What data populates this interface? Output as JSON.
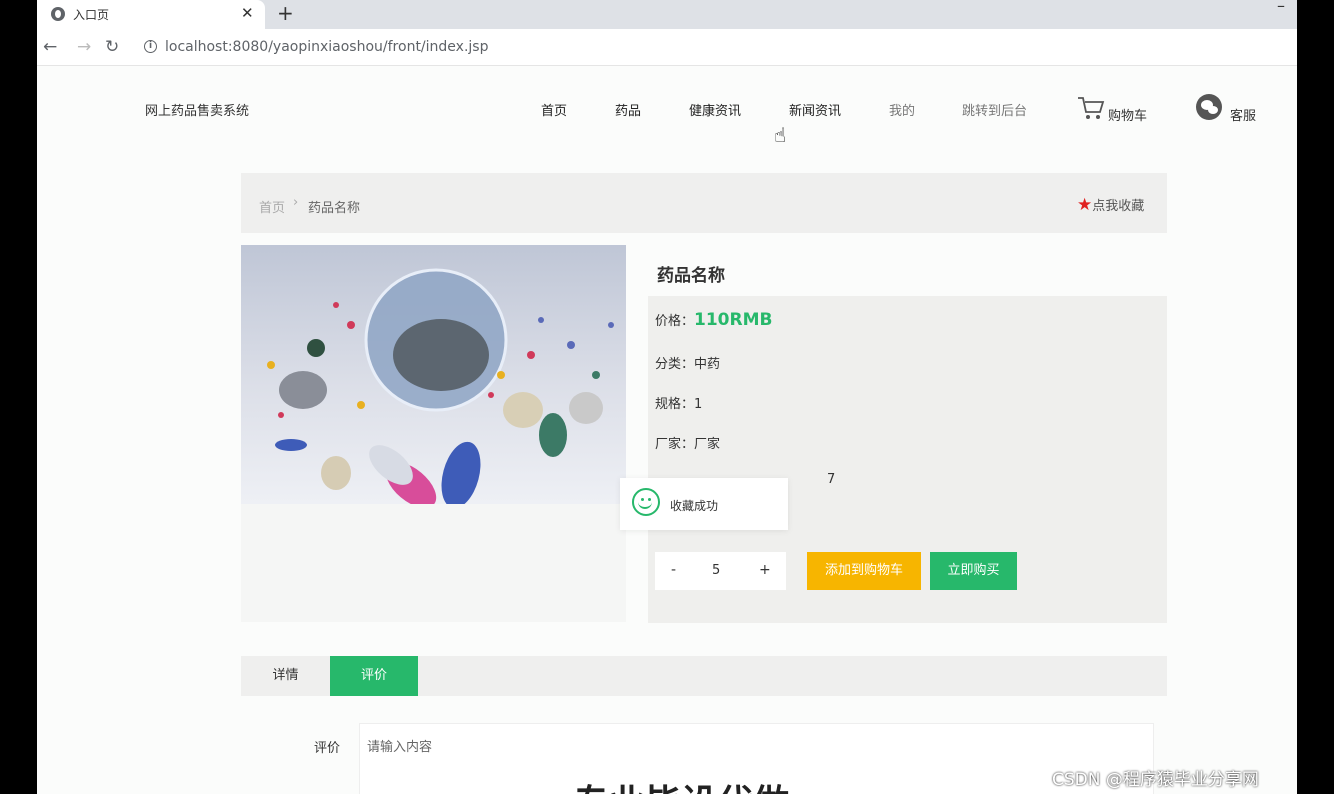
{
  "browser": {
    "tab_title": "入口页",
    "url": "localhost:8080/yaopinxiaoshou/front/index.jsp"
  },
  "header": {
    "site_title": "网上药品售卖系统",
    "nav": [
      "首页",
      "药品",
      "健康资讯",
      "新闻资讯",
      "我的",
      "跳转到后台"
    ],
    "cart_label": "购物车",
    "service_label": "客服"
  },
  "breadcrumb": {
    "home": "首页",
    "separator": "›",
    "current": "药品名称",
    "favorite_label": "点我收藏"
  },
  "product": {
    "name": "药品名称",
    "price_label": "价格：",
    "price_value": "110RMB",
    "category_label": "分类：",
    "category_value": "中药",
    "spec_label": "规格：",
    "spec_value": "1",
    "maker_label": "厂家：",
    "maker_value": "厂家",
    "partial_value": "7",
    "quantity": "5",
    "minus": "-",
    "plus": "+",
    "add_to_cart": "添加到购物车",
    "buy_now": "立即购买"
  },
  "toast": {
    "message": "收藏成功"
  },
  "tabs": {
    "detail": "详情",
    "review": "评价"
  },
  "review": {
    "label": "评价",
    "placeholder": "请输入内容"
  },
  "overlay": {
    "big_text": "专业毕设代做",
    "watermark": "CSDN @程序猿毕业分享网"
  },
  "colors": {
    "accent_green": "#27b86b",
    "cart_orange": "#f7b500",
    "star_red": "#e02020"
  }
}
